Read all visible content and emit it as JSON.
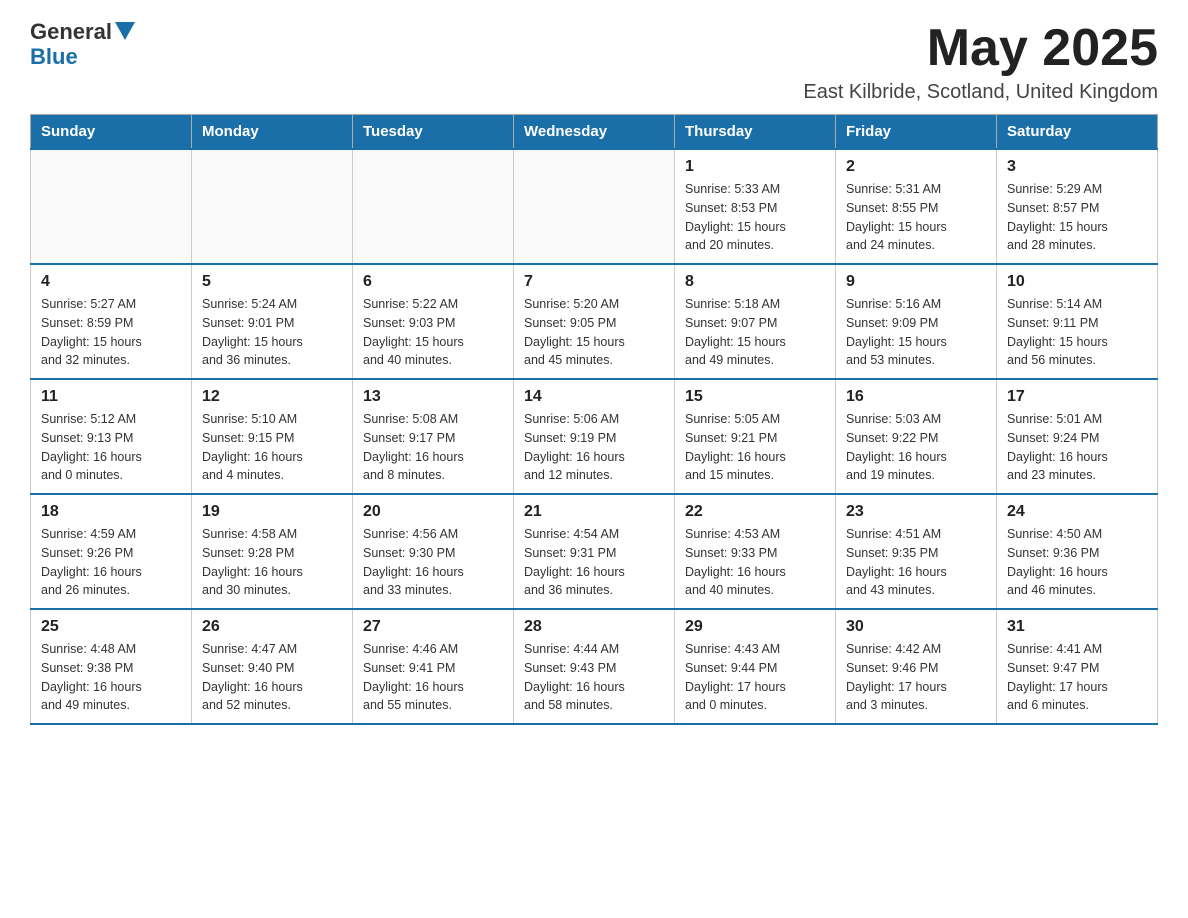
{
  "logo": {
    "text_general": "General",
    "text_blue": "Blue"
  },
  "header": {
    "month_year": "May 2025",
    "location": "East Kilbride, Scotland, United Kingdom"
  },
  "weekdays": [
    "Sunday",
    "Monday",
    "Tuesday",
    "Wednesday",
    "Thursday",
    "Friday",
    "Saturday"
  ],
  "weeks": [
    [
      {
        "day": "",
        "detail": ""
      },
      {
        "day": "",
        "detail": ""
      },
      {
        "day": "",
        "detail": ""
      },
      {
        "day": "",
        "detail": ""
      },
      {
        "day": "1",
        "detail": "Sunrise: 5:33 AM\nSunset: 8:53 PM\nDaylight: 15 hours\nand 20 minutes."
      },
      {
        "day": "2",
        "detail": "Sunrise: 5:31 AM\nSunset: 8:55 PM\nDaylight: 15 hours\nand 24 minutes."
      },
      {
        "day": "3",
        "detail": "Sunrise: 5:29 AM\nSunset: 8:57 PM\nDaylight: 15 hours\nand 28 minutes."
      }
    ],
    [
      {
        "day": "4",
        "detail": "Sunrise: 5:27 AM\nSunset: 8:59 PM\nDaylight: 15 hours\nand 32 minutes."
      },
      {
        "day": "5",
        "detail": "Sunrise: 5:24 AM\nSunset: 9:01 PM\nDaylight: 15 hours\nand 36 minutes."
      },
      {
        "day": "6",
        "detail": "Sunrise: 5:22 AM\nSunset: 9:03 PM\nDaylight: 15 hours\nand 40 minutes."
      },
      {
        "day": "7",
        "detail": "Sunrise: 5:20 AM\nSunset: 9:05 PM\nDaylight: 15 hours\nand 45 minutes."
      },
      {
        "day": "8",
        "detail": "Sunrise: 5:18 AM\nSunset: 9:07 PM\nDaylight: 15 hours\nand 49 minutes."
      },
      {
        "day": "9",
        "detail": "Sunrise: 5:16 AM\nSunset: 9:09 PM\nDaylight: 15 hours\nand 53 minutes."
      },
      {
        "day": "10",
        "detail": "Sunrise: 5:14 AM\nSunset: 9:11 PM\nDaylight: 15 hours\nand 56 minutes."
      }
    ],
    [
      {
        "day": "11",
        "detail": "Sunrise: 5:12 AM\nSunset: 9:13 PM\nDaylight: 16 hours\nand 0 minutes."
      },
      {
        "day": "12",
        "detail": "Sunrise: 5:10 AM\nSunset: 9:15 PM\nDaylight: 16 hours\nand 4 minutes."
      },
      {
        "day": "13",
        "detail": "Sunrise: 5:08 AM\nSunset: 9:17 PM\nDaylight: 16 hours\nand 8 minutes."
      },
      {
        "day": "14",
        "detail": "Sunrise: 5:06 AM\nSunset: 9:19 PM\nDaylight: 16 hours\nand 12 minutes."
      },
      {
        "day": "15",
        "detail": "Sunrise: 5:05 AM\nSunset: 9:21 PM\nDaylight: 16 hours\nand 15 minutes."
      },
      {
        "day": "16",
        "detail": "Sunrise: 5:03 AM\nSunset: 9:22 PM\nDaylight: 16 hours\nand 19 minutes."
      },
      {
        "day": "17",
        "detail": "Sunrise: 5:01 AM\nSunset: 9:24 PM\nDaylight: 16 hours\nand 23 minutes."
      }
    ],
    [
      {
        "day": "18",
        "detail": "Sunrise: 4:59 AM\nSunset: 9:26 PM\nDaylight: 16 hours\nand 26 minutes."
      },
      {
        "day": "19",
        "detail": "Sunrise: 4:58 AM\nSunset: 9:28 PM\nDaylight: 16 hours\nand 30 minutes."
      },
      {
        "day": "20",
        "detail": "Sunrise: 4:56 AM\nSunset: 9:30 PM\nDaylight: 16 hours\nand 33 minutes."
      },
      {
        "day": "21",
        "detail": "Sunrise: 4:54 AM\nSunset: 9:31 PM\nDaylight: 16 hours\nand 36 minutes."
      },
      {
        "day": "22",
        "detail": "Sunrise: 4:53 AM\nSunset: 9:33 PM\nDaylight: 16 hours\nand 40 minutes."
      },
      {
        "day": "23",
        "detail": "Sunrise: 4:51 AM\nSunset: 9:35 PM\nDaylight: 16 hours\nand 43 minutes."
      },
      {
        "day": "24",
        "detail": "Sunrise: 4:50 AM\nSunset: 9:36 PM\nDaylight: 16 hours\nand 46 minutes."
      }
    ],
    [
      {
        "day": "25",
        "detail": "Sunrise: 4:48 AM\nSunset: 9:38 PM\nDaylight: 16 hours\nand 49 minutes."
      },
      {
        "day": "26",
        "detail": "Sunrise: 4:47 AM\nSunset: 9:40 PM\nDaylight: 16 hours\nand 52 minutes."
      },
      {
        "day": "27",
        "detail": "Sunrise: 4:46 AM\nSunset: 9:41 PM\nDaylight: 16 hours\nand 55 minutes."
      },
      {
        "day": "28",
        "detail": "Sunrise: 4:44 AM\nSunset: 9:43 PM\nDaylight: 16 hours\nand 58 minutes."
      },
      {
        "day": "29",
        "detail": "Sunrise: 4:43 AM\nSunset: 9:44 PM\nDaylight: 17 hours\nand 0 minutes."
      },
      {
        "day": "30",
        "detail": "Sunrise: 4:42 AM\nSunset: 9:46 PM\nDaylight: 17 hours\nand 3 minutes."
      },
      {
        "day": "31",
        "detail": "Sunrise: 4:41 AM\nSunset: 9:47 PM\nDaylight: 17 hours\nand 6 minutes."
      }
    ]
  ]
}
